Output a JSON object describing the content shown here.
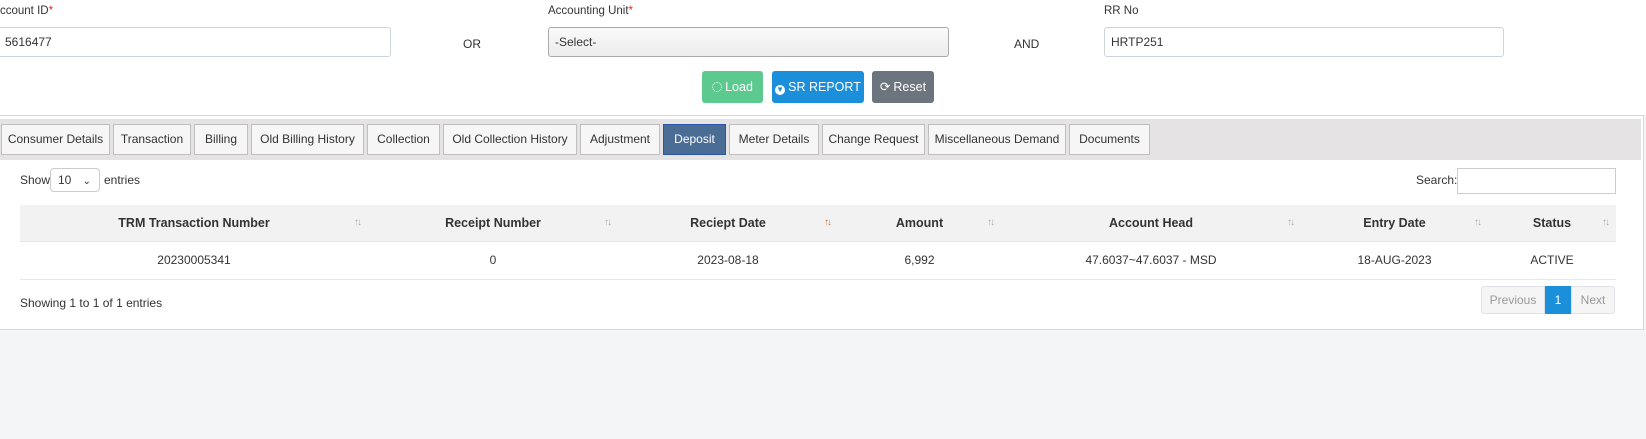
{
  "form": {
    "account_id": {
      "label": "ccount ID",
      "required": "*",
      "value": "5616477"
    },
    "or_text": "OR",
    "accounting_unit": {
      "label": "Accounting Unit",
      "required": "*",
      "value": "-Select-"
    },
    "and_text": "AND",
    "rr_no": {
      "label": "RR No",
      "value": "HRTP251"
    }
  },
  "buttons": {
    "load": "Load",
    "sr_report": "SR REPORT",
    "reset": "Reset"
  },
  "tabs": [
    "Consumer Details",
    "Transaction",
    "Billing",
    "Old Billing History",
    "Collection",
    "Old Collection History",
    "Adjustment",
    "Deposit",
    "Meter Details",
    "Change Request",
    "Miscellaneous Demand",
    "Documents"
  ],
  "active_tab": "Deposit",
  "table_controls": {
    "show_label": "Show",
    "entries_value": "10",
    "entries_label": "entries",
    "search_label": "Search:"
  },
  "table": {
    "columns": [
      "TRM Transaction Number",
      "Receipt Number",
      "Reciept Date",
      "Amount",
      "Account Head",
      "Entry Date",
      "Status"
    ],
    "rows": [
      [
        "20230005341",
        "0",
        "2023-08-18",
        "6,992",
        "47.6037~47.6037 - MSD",
        "18-AUG-2023",
        "ACTIVE"
      ]
    ]
  },
  "footer": {
    "info": "Showing 1 to 1 of 1 entries",
    "prev": "Previous",
    "page": "1",
    "next": "Next"
  },
  "colors": {
    "load": "#5cc98e",
    "sr_report": "#1b8fd9",
    "reset": "#6c757d",
    "active_tab": "#4a6d96"
  }
}
